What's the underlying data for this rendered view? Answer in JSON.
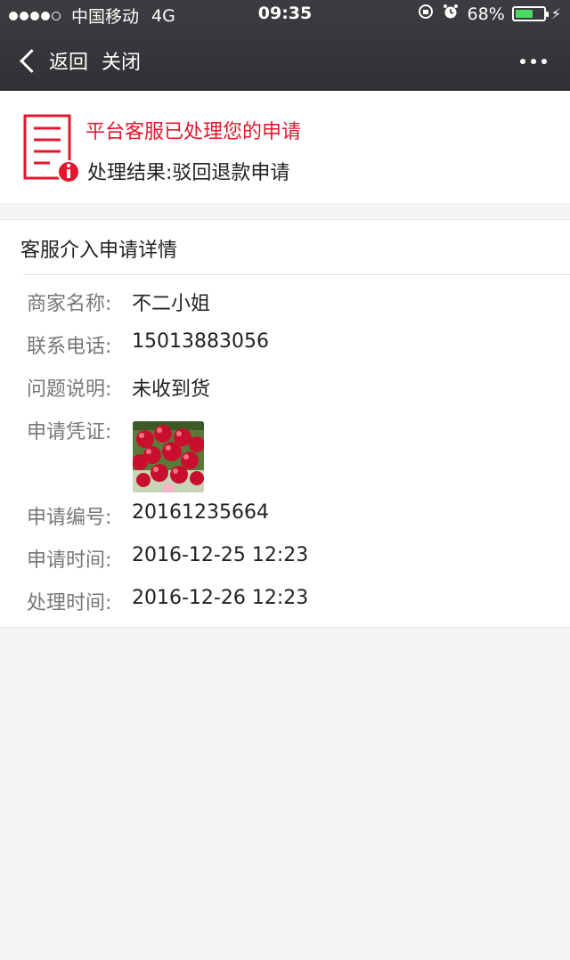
{
  "status_bar": {
    "carrier": "中国移动",
    "network": "4G",
    "time": "09:35",
    "battery": "68%",
    "battery_level": 0.68,
    "signal_bars_filled": 4,
    "signal_bars_total": 5
  },
  "nav": {
    "back_label": "返回",
    "close_label": "关闭"
  },
  "result": {
    "title": "平台客服已处理您的申请",
    "subtitle": "处理结果:驳回退款申请"
  },
  "detail": {
    "title": "客服介入申请详情",
    "rows": [
      {
        "label": "商家名称:",
        "value": "不二小姐"
      },
      {
        "label": "联系电话:",
        "value": "15013883056"
      },
      {
        "label": "问题说明:",
        "value": "未收到货"
      },
      {
        "label": "申请凭证:",
        "value": ""
      },
      {
        "label": "申请编号:",
        "value": "20161235664"
      },
      {
        "label": "申请时间:",
        "value": "2016-12-25 12:23"
      },
      {
        "label": "处理时间:",
        "value": "2016-12-26 12:23"
      }
    ]
  },
  "colors": {
    "accent_red": "#e3182e",
    "header_bg": "#333538",
    "battery_green": "#4cd964"
  }
}
